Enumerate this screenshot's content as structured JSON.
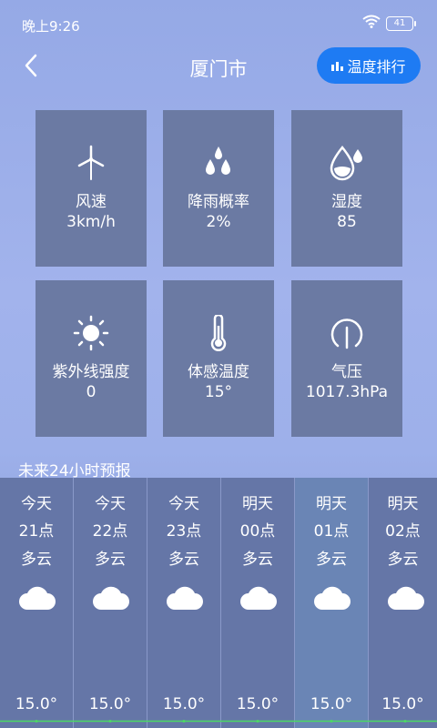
{
  "status": {
    "time": "晚上9:26",
    "battery": "41"
  },
  "header": {
    "title": "厦门市",
    "rank_button": "温度排行"
  },
  "cards": [
    {
      "label": "风速",
      "value": "3km/h",
      "icon": "wind-turbine-icon"
    },
    {
      "label": "降雨概率",
      "value": "2%",
      "icon": "raindrops-icon"
    },
    {
      "label": "湿度",
      "value": "85",
      "icon": "humidity-drop-icon"
    },
    {
      "label": "紫外线强度",
      "value": "0",
      "icon": "sun-icon"
    },
    {
      "label": "体感温度",
      "value": "15°",
      "icon": "thermometer-icon"
    },
    {
      "label": "气压",
      "value": "1017.3hPa",
      "icon": "pressure-gauge-icon"
    }
  ],
  "forecast": {
    "title": "未来24小时预报",
    "hours": [
      {
        "day": "今天",
        "hour": "21点",
        "condition": "多云",
        "temp": "15.0°"
      },
      {
        "day": "今天",
        "hour": "22点",
        "condition": "多云",
        "temp": "15.0°"
      },
      {
        "day": "今天",
        "hour": "23点",
        "condition": "多云",
        "temp": "15.0°"
      },
      {
        "day": "明天",
        "hour": "00点",
        "condition": "多云",
        "temp": "15.0°"
      },
      {
        "day": "明天",
        "hour": "01点",
        "condition": "多云",
        "temp": "15.0°"
      },
      {
        "day": "明天",
        "hour": "02点",
        "condition": "多云",
        "temp": "15.0°"
      }
    ]
  },
  "colors": {
    "accent": "#1e7bf3",
    "card_bg": "#6b7aa3",
    "temp_line": "#4cd964"
  }
}
